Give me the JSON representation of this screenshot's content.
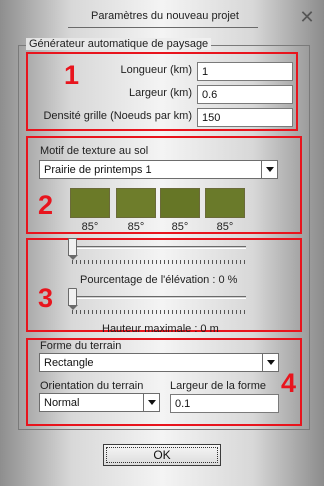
{
  "window": {
    "title": "Paramètres du nouveau projet",
    "close_glyph": "✕"
  },
  "group": {
    "title": "Générateur automatique de paysage"
  },
  "section1": {
    "number": "1",
    "fields": [
      {
        "label": "Longueur (km)",
        "value": "1"
      },
      {
        "label": "Largeur (km)",
        "value": "0.6"
      },
      {
        "label": "Densité grille (Noeuds par km)",
        "value": "150"
      }
    ]
  },
  "section2": {
    "number": "2",
    "label": "Motif de texture au sol",
    "selected": "Prairie de printemps 1",
    "swatches": [
      {
        "caption": "85°",
        "color": "#6b7a28"
      },
      {
        "caption": "85°",
        "color": "#6e7d2b"
      },
      {
        "caption": "85°",
        "color": "#667626"
      },
      {
        "caption": "85°",
        "color": "#6a7a2a"
      }
    ]
  },
  "section3": {
    "number": "3",
    "slider1_label": "Pourcentage de l'élévation : 0 %",
    "slider1_value": 0,
    "slider2_label": "Hauteur maximale : 0 m",
    "slider2_value": 0
  },
  "section4": {
    "number": "4",
    "shape_label": "Forme du terrain",
    "shape_selected": "Rectangle",
    "orientation_label": "Orientation du terrain",
    "orientation_selected": "Normal",
    "width_label": "Largeur de la forme",
    "width_value": "0.1"
  },
  "buttons": {
    "ok": "OK"
  },
  "colors": {
    "highlight": "#e8141d"
  }
}
